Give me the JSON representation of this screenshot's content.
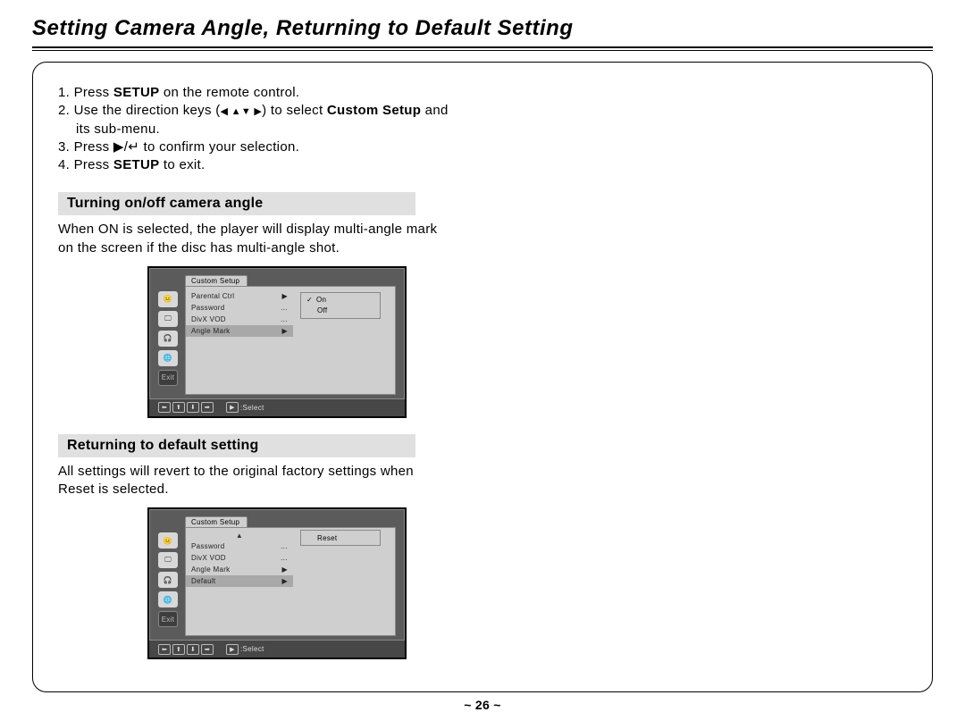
{
  "page_title": "Setting Camera Angle, Returning to Default Setting",
  "page_footer": "~ 26 ~",
  "intro": {
    "step1_a": "1. Press ",
    "step1_b": "SETUP",
    "step1_c": " on the remote control.",
    "step2_a": "2. Use the direction keys (",
    "step2_arrows": "◀ ▲▼ ▶",
    "step2_b": ") to select ",
    "step2_bold": "Custom Setup",
    "step2_c": " and",
    "step2_line2": "its sub-menu.",
    "step3_a": "3. Press ",
    "step3_sym": "▶/↵",
    "step3_b": " to confirm your selection.",
    "step4_a": "4. Press ",
    "step4_b": "SETUP",
    "step4_c": " to exit."
  },
  "section1": {
    "heading": "Turning on/off camera angle",
    "body1": "When ON is selected, the player will display multi-angle mark",
    "body2": "on the screen if the disc has multi-angle shot."
  },
  "section2": {
    "heading": "Returning to default setting",
    "body1": "All settings will revert to the original factory settings when",
    "body2": "Reset is selected."
  },
  "screenshot1": {
    "tab": "Custom Setup",
    "menu": [
      {
        "label": "Parental Ctrl",
        "ind": "▶"
      },
      {
        "label": "Password",
        "ind": "…"
      },
      {
        "label": "DivX VOD",
        "ind": "…"
      },
      {
        "label": "Angle Mark",
        "ind": "▶",
        "sel": true
      }
    ],
    "submenu": [
      {
        "label": "On",
        "check": true
      },
      {
        "label": "Off"
      }
    ],
    "footer_label": ":Select"
  },
  "screenshot2": {
    "tab": "Custom Setup",
    "scroll_up": "▲",
    "menu": [
      {
        "label": "Password",
        "ind": "…"
      },
      {
        "label": "DivX VOD",
        "ind": "…"
      },
      {
        "label": "Angle Mark",
        "ind": "▶"
      },
      {
        "label": "Default",
        "ind": "▶",
        "sel": true
      }
    ],
    "submenu_single": "Reset",
    "footer_label": ":Select"
  },
  "icons": {
    "check": "✓",
    "left": "⬅",
    "up": "⬆",
    "down": "⬇",
    "right": "➡",
    "play": "▶"
  }
}
